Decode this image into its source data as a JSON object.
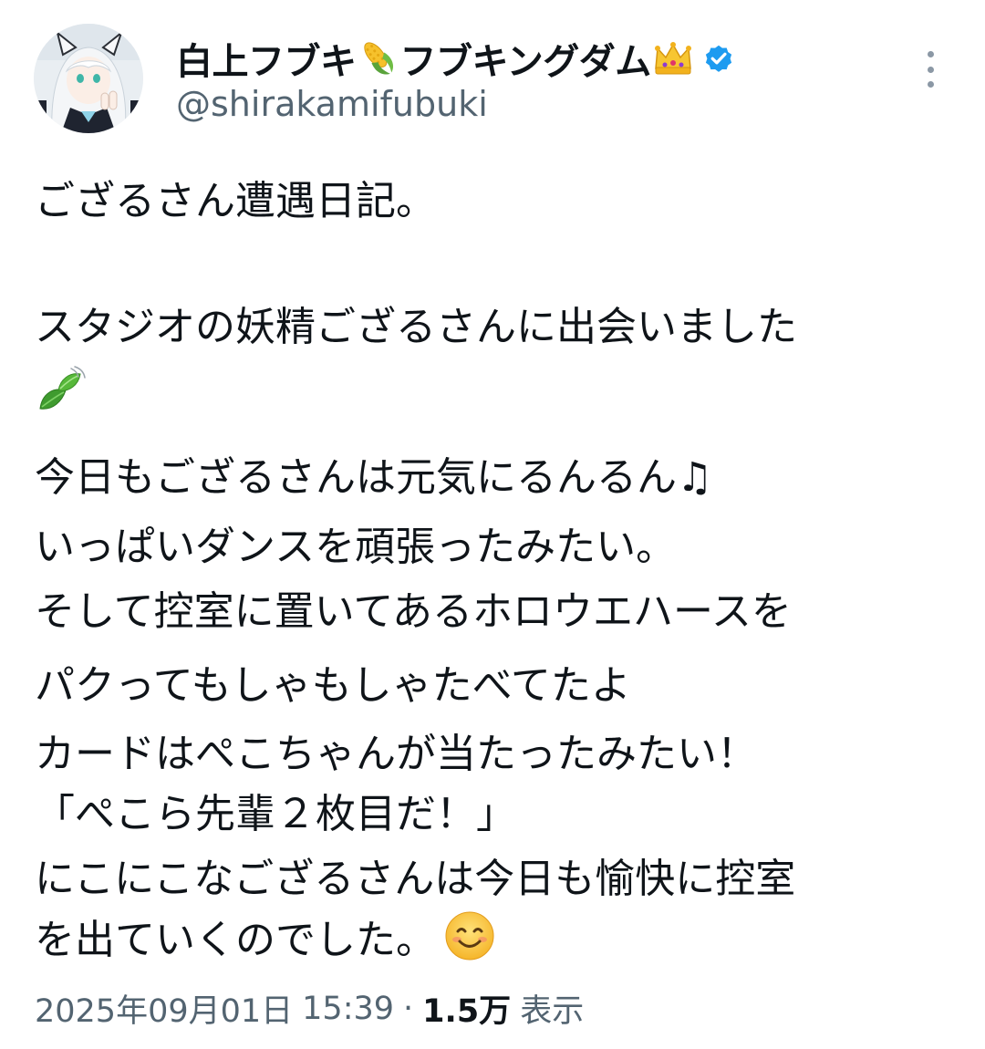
{
  "user": {
    "display_name_part1": "白上フブキ",
    "display_name_part2": "フブキングダム",
    "name_emoji_1": "corn-icon",
    "name_emoji_2": "crown-icon",
    "handle": "@shirakamifubuki",
    "verified": true,
    "verified_color": "#1d9bf0"
  },
  "tweet": {
    "lines": [
      "ござるさん遭遇日記。",
      "スタジオの妖精ござるさんに出会いました",
      "今日もござるさんは元気にるんるん♫",
      "いっぱいダンスを頑張ったみたい。",
      "そして控室に置いてあるホロウエハースを",
      "パクってもしゃもしゃたべてたよ",
      "カードはぺこちゃんが当たったみたい！",
      "「ぺこら先輩２枚目だ！」",
      "にこにこなござるさんは今日も愉快に控室",
      "を出ていくのでした。"
    ],
    "leaf_emoji": "leaf-fluttering-icon",
    "smile_emoji": "smiling-face-icon"
  },
  "meta": {
    "date": "2025年09月01日",
    "time": "15:39",
    "separator": "·",
    "views_count": "1.5万",
    "views_label": "表示"
  },
  "colors": {
    "text": "#0f1419",
    "secondary": "#536471",
    "accent": "#1d9bf0"
  }
}
